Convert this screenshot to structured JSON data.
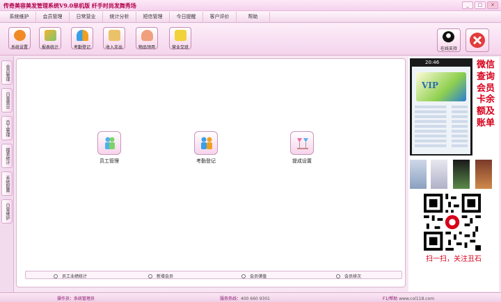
{
  "window": {
    "title": "传奇美容美发管理系统V9.0单机版  纤手时尚发舞秀场",
    "min": "_",
    "max": "□",
    "close": "×"
  },
  "menu": [
    "系统维护",
    "会员管理",
    "日常营业",
    "统计分析",
    "短信管理",
    "今日提醒",
    "客户评价",
    "帮助"
  ],
  "toolbar": {
    "items": [
      {
        "label": "系统设置",
        "icon": "gear-icon",
        "color": "#f08a24"
      },
      {
        "label": "报表统计",
        "icon": "report-icon",
        "color": "#f5b431"
      },
      {
        "label": "考勤登记",
        "icon": "attendance-icon",
        "color": "#3aa0e6"
      },
      {
        "label": "收入支出",
        "icon": "ledger-icon",
        "color": "#e9c26a"
      },
      {
        "label": "物品领用",
        "icon": "hand-icon",
        "color": "#f0a07c"
      },
      {
        "label": "营业交班",
        "icon": "handover-icon",
        "color": "#f2d23a"
      }
    ],
    "online": {
      "label": "在线支持",
      "icon": "qq-penguin-icon"
    },
    "exit": {
      "label": "",
      "icon": "exit-x-icon"
    }
  },
  "sidebar": [
    "会员管理",
    "日常营业",
    "员工管理",
    "报表统计",
    "系统配置",
    "日常维护"
  ],
  "main": {
    "functions": [
      {
        "label": "员工管理",
        "icon": "staff-icon"
      },
      {
        "label": "考勤登记",
        "icon": "attendance-icon"
      },
      {
        "label": "提成设置",
        "icon": "commission-icon"
      }
    ],
    "radios": [
      "员工业绩统计",
      "新增会员",
      "会员储值",
      "会员续次"
    ]
  },
  "ad": {
    "phone_time": "20:46",
    "vip": "VIP",
    "vertical_text": "微信查询会员卡余额及账单",
    "qr_caption": "扫一扫，关注丑石"
  },
  "status": {
    "operator_label": "操作员：",
    "operator": "系统管理员",
    "hotline_label": "服务热线：",
    "hotline": "400 660 9301",
    "help_label": "F1/帮助",
    "help_url": "www.col118.com"
  },
  "colors": {
    "accent": "#b0004a",
    "red": "#d7001a",
    "pink_bg": "#f7e6f3"
  }
}
